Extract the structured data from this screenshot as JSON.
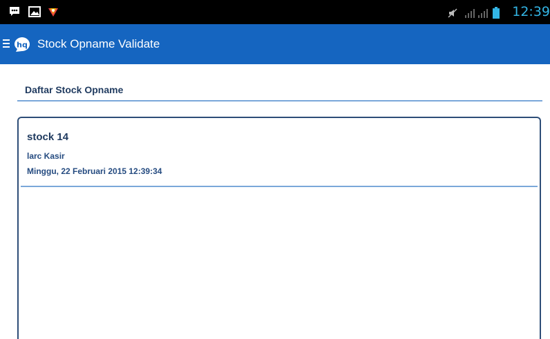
{
  "status_bar": {
    "time": "12:39",
    "icons": [
      "bbm-icon",
      "gallery-icon",
      "vivo-icon",
      "mute-icon",
      "signal-icon",
      "signal-icon",
      "battery-icon"
    ],
    "time_color": "#33b5e5"
  },
  "action_bar": {
    "title": "Stock Opname Validate",
    "logo_text": "hq",
    "background_color": "#1565c0"
  },
  "section": {
    "title": "Daftar Stock Opname"
  },
  "card": {
    "title": "stock 14",
    "user": "larc Kasir",
    "date": "Minggu, 22 Februari 2015 12:39:34"
  }
}
